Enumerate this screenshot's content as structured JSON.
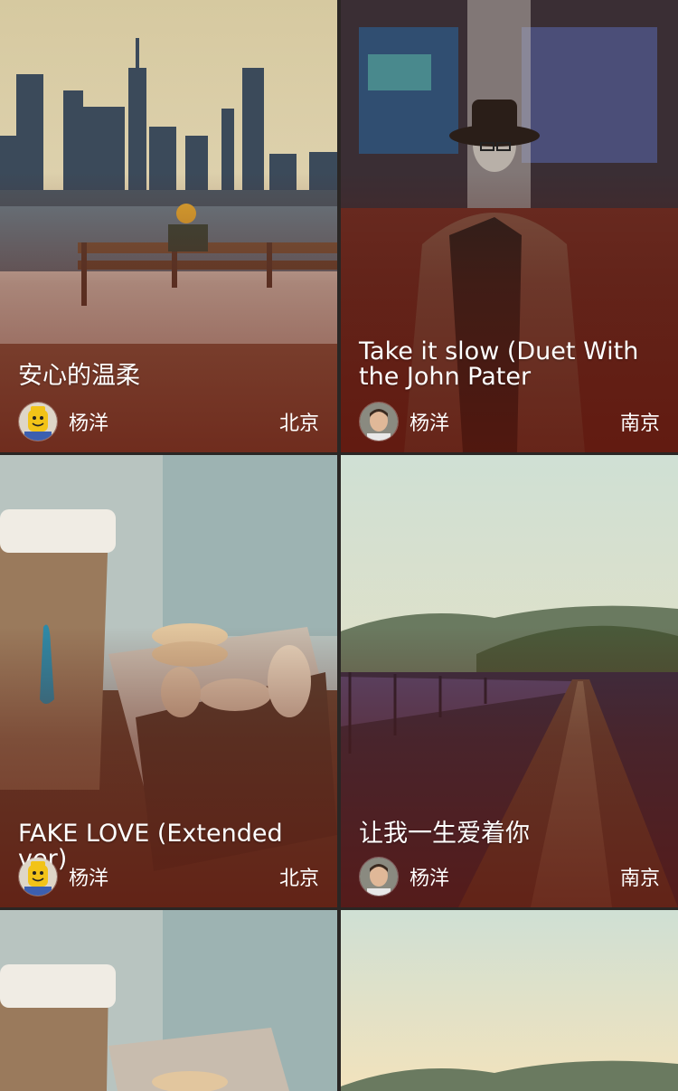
{
  "cards": [
    {
      "title": "安心的温柔",
      "author": "杨洋",
      "city": "北京",
      "avatar": "lego-avatar",
      "image": "city-skyline-bench"
    },
    {
      "title": "Take it slow (Duet With the John Pater",
      "author": "杨洋",
      "city": "南京",
      "avatar": "man-photo-avatar",
      "image": "man-in-hat-street"
    },
    {
      "title": "FAKE LOVE (Extended ver)",
      "author": "杨洋",
      "city": "北京",
      "avatar": "lego-avatar",
      "image": "coffee-macarons"
    },
    {
      "title": "让我一生爱着你",
      "author": "杨洋",
      "city": "南京",
      "avatar": "man-photo-avatar",
      "image": "railway-bridge"
    },
    {
      "image": "coffee-macarons"
    },
    {
      "image": "railway-bridge"
    }
  ]
}
